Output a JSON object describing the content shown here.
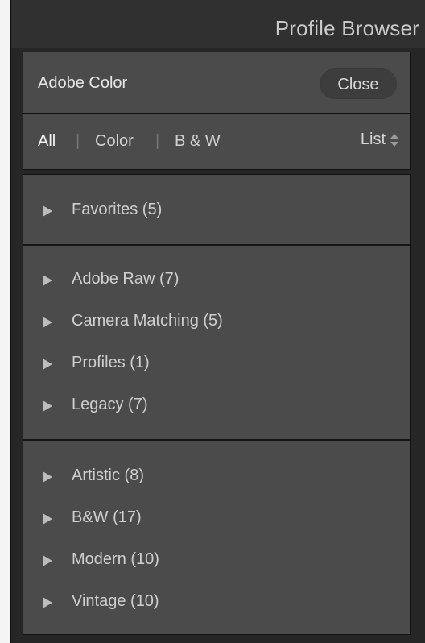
{
  "header": {
    "title": "Profile Browser"
  },
  "current_profile": {
    "name": "Adobe Color",
    "close_label": "Close"
  },
  "filters": {
    "items": [
      "All",
      "Color",
      "B & W"
    ],
    "separator": "|",
    "active": "All",
    "view_label": "List"
  },
  "groups": [
    {
      "items": [
        "Favorites (5)"
      ]
    },
    {
      "items": [
        "Adobe Raw (7)",
        "Camera Matching (5)",
        "Profiles (1)",
        "Legacy (7)"
      ]
    },
    {
      "items": [
        "Artistic (8)",
        "B&W (17)",
        "Modern (10)",
        "Vintage (10)"
      ]
    }
  ],
  "icons": {
    "expand": "triangle-right-icon",
    "view_select": "up-down-arrows-icon"
  },
  "colors": {
    "panel": "#4b4b4b",
    "header": "#303030",
    "text": "#cfcfcf"
  }
}
